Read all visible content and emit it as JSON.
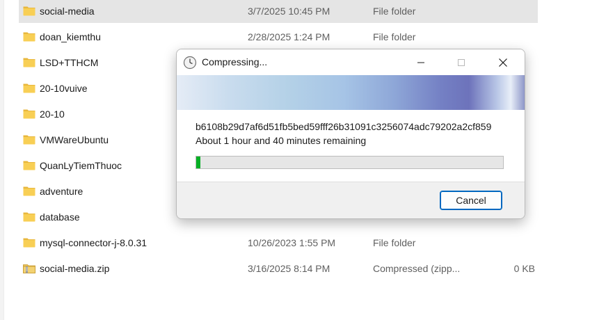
{
  "files": [
    {
      "name": "social-media",
      "date": "3/7/2025 10:45 PM",
      "type": "File folder",
      "size": "",
      "icon": "folder-icon",
      "selected": true
    },
    {
      "name": "doan_kiemthu",
      "date": "2/28/2025 1:24 PM",
      "type": "File folder",
      "size": "",
      "icon": "folder-icon"
    },
    {
      "name": "LSD+TTHCM",
      "date": "",
      "type": "",
      "size": "",
      "icon": "folder-icon"
    },
    {
      "name": "20-10vuive",
      "date": "",
      "type": "",
      "size": "",
      "icon": "folder-icon"
    },
    {
      "name": "20-10",
      "date": "",
      "type": "",
      "size": "",
      "icon": "folder-icon"
    },
    {
      "name": "VMWareUbuntu",
      "date": "",
      "type": "",
      "size": "",
      "icon": "folder-icon"
    },
    {
      "name": "QuanLyTiemThuoc",
      "date": "",
      "type": "",
      "size": "",
      "icon": "folder-icon"
    },
    {
      "name": "adventure",
      "date": "",
      "type": "",
      "size": "",
      "icon": "folder-icon"
    },
    {
      "name": "database",
      "date": "",
      "type": "",
      "size": "",
      "icon": "folder-icon"
    },
    {
      "name": "mysql-connector-j-8.0.31",
      "date": "10/26/2023 1:55 PM",
      "type": "File folder",
      "size": "",
      "icon": "folder-icon"
    },
    {
      "name": "social-media.zip",
      "date": "3/16/2025 8:14 PM",
      "type": "Compressed (zipp...",
      "size": "0 KB",
      "icon": "zip-folder-icon"
    }
  ],
  "dialog": {
    "title": "Compressing...",
    "filename": "b6108b29d7af6d51fb5bed59fff26b31091c3256074adc79202a2cf859",
    "time_remaining": "About 1 hour and 40 minutes remaining",
    "progress_percent": 1.4,
    "progress_color": "#06b025",
    "cancel_label": "Cancel"
  }
}
